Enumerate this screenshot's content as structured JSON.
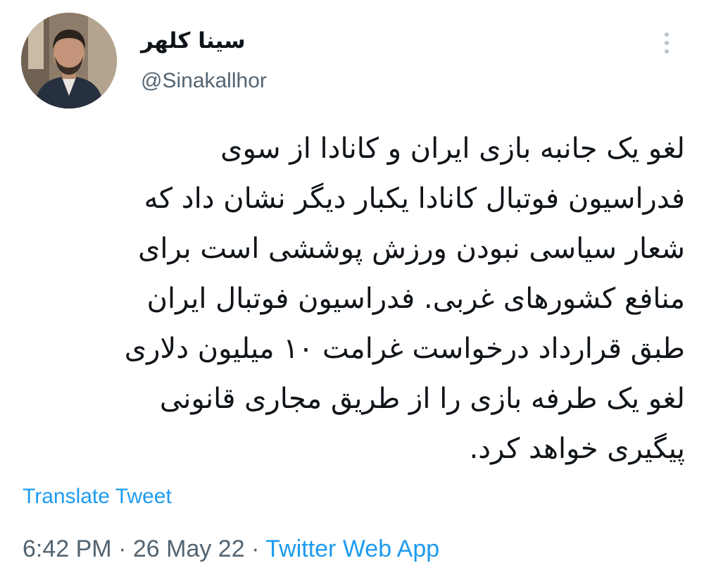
{
  "author": {
    "display_name": "سینا کلهر",
    "handle": "@Sinakallhor",
    "avatar_icon": "profile-photo"
  },
  "tweet": {
    "text_lines": [
      "لغو یک جانبه بازی ایران و کانادا از سوی",
      "فدراسیون فوتبال کانادا یکبار دیگر نشان داد که",
      "شعار سیاسی نبودن ورزش پوششی است برای",
      "منافع کشورهای غربی. فدراسیون فوتبال ایران",
      "طبق قرارداد درخواست غرامت ۱۰ میلیون دلاری",
      "لغو یک طرفه بازی را از طریق مجاری قانونی",
      "پیگیری خواهد کرد."
    ],
    "translate_label": "Translate Tweet",
    "time": "6:42 PM",
    "separator": "·",
    "date": "26 May 22",
    "source": "Twitter Web App"
  },
  "colors": {
    "link": "#1d9bf0",
    "secondary_text": "#536471",
    "primary_text": "#0f1419"
  },
  "icons": {
    "more": "more-vertical-icon"
  }
}
